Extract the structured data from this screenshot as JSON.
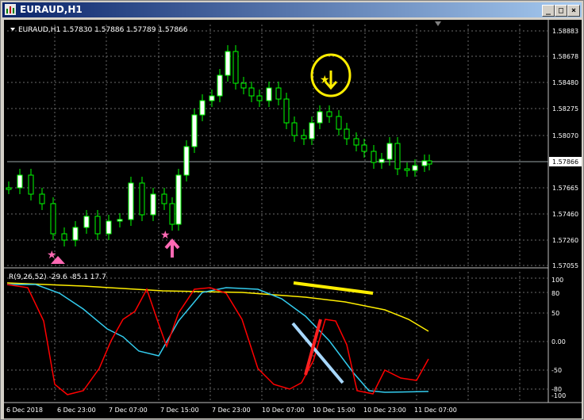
{
  "window": {
    "title": "EURAUD,H1",
    "buttons": [
      "_",
      "□",
      "×"
    ]
  },
  "chart": {
    "header": "EURAUD,H1  1.57830 1.57886 1.57789 1.57866",
    "price_labels": [
      "1.58883",
      "1.58678",
      "1.58480",
      "1.58275",
      "1.58070",
      "1.57865",
      "1.57665",
      "1.57460",
      "1.57260",
      "1.57055"
    ],
    "current_price": "1.57866",
    "bid_color": "#9aa4a6"
  },
  "indicator": {
    "header": "R(9,26,52) -29.6 -85.1 17.7",
    "levels": [
      "100",
      "80",
      "50",
      "0.00",
      "-50",
      "-80",
      "-100"
    ]
  },
  "time_labels": [
    "6 Dec 2018",
    "6 Dec 23:00",
    "7 Dec 07:00",
    "7 Dec 15:00",
    "7 Dec 23:00",
    "10 Dec 07:00",
    "10 Dec 15:00",
    "10 Dec 23:00",
    "11 Dec 07:00"
  ],
  "colors": {
    "up": "#ffffff",
    "down": "#000000",
    "wick": "#00ff00",
    "pink": "#ff69b4",
    "yellow": "#ffee00",
    "red": "#ff0000",
    "cyan": "#33ccee"
  }
}
